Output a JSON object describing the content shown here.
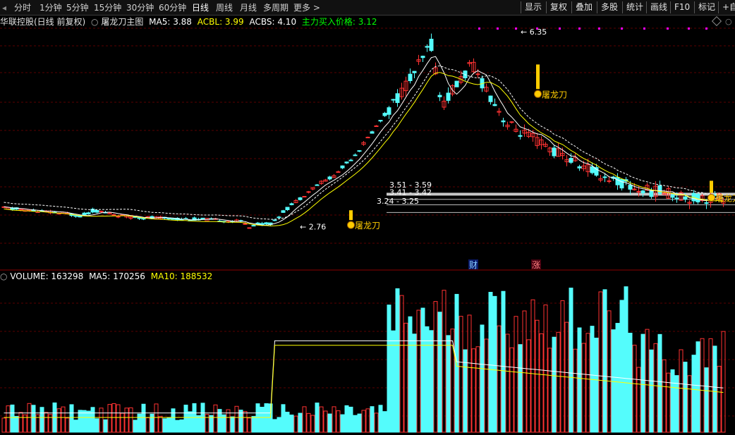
{
  "toolbar": {
    "periods": [
      "分时",
      "1分钟",
      "5分钟",
      "15分钟",
      "30分钟",
      "60分钟",
      "日线",
      "周线",
      "月线",
      "多周期",
      "更多 >"
    ],
    "active_period": "日线",
    "right_buttons": [
      "显示",
      "复权",
      "叠加",
      "多股",
      "统计",
      "画线",
      "F10",
      "标记",
      "+自选"
    ]
  },
  "main_info": {
    "stock_title": "华联控股(日线 前复权)",
    "indicator_name": "屠龙刀主图",
    "ma5": "MA5: 3.88",
    "acbl": "ACBL: 3.99",
    "acbs": "ACBS: 4.10",
    "main_force_price": "主力买入价格: 3.12"
  },
  "volume_info": {
    "label": "VOLUME: 163298",
    "ma5": "MA5: 170256",
    "ma10": "MA10: 188532"
  },
  "annotations": {
    "high_label": "6.35",
    "low_label": "2.76",
    "range1": "3.51 - 3.59",
    "range2": "3.41 - 3.42",
    "range3": "3.24 - 3.25",
    "signal_text": "屠龙刀",
    "marker_cai": "财",
    "marker_zhang": "涨"
  },
  "colors": {
    "up": "#ff3232",
    "down": "#54fcfc",
    "ma_white": "#ffffff",
    "ma_yellow": "#ffff00",
    "signal": "#ffcc00",
    "info_green": "#00ff00"
  }
}
